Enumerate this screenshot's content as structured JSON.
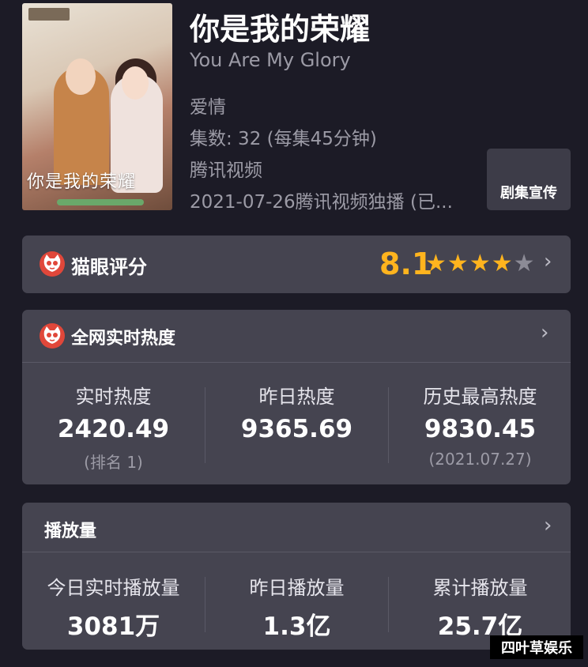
{
  "show": {
    "title": "你是我的荣耀",
    "subtitle": "You Are My Glory",
    "genre": "爱情",
    "episodes": "集数: 32  (每集45分钟)",
    "platform": "腾讯视频",
    "release": "2021-07-26腾讯视频独播 (已...",
    "poster_title": "你是我的荣耀",
    "promo_button": "剧集宣传"
  },
  "rating": {
    "label": "猫眼评分",
    "score": "8.1",
    "stars_filled": 4,
    "stars_total": 5,
    "chevron": "›"
  },
  "heat": {
    "title": "全网实时热度",
    "chevron": "›",
    "stats": [
      {
        "label": "实时热度",
        "value": "2420.49",
        "sub": "(排名 1)"
      },
      {
        "label": "昨日热度",
        "value": "9365.69",
        "sub": ""
      },
      {
        "label": "历史最高热度",
        "value": "9830.45",
        "sub": "(2021.07.27)"
      }
    ]
  },
  "plays": {
    "title": "播放量",
    "chevron": "›",
    "stats": [
      {
        "label": "今日实时播放量",
        "value": "3081万"
      },
      {
        "label": "昨日播放量",
        "value": "1.3亿"
      },
      {
        "label": "累计播放量",
        "value": "25.7亿"
      }
    ]
  },
  "watermark": "四叶草娱乐",
  "colors": {
    "background": "#1c1b26",
    "card": "#454450",
    "accent_score": "#ffb41e",
    "maoyan_red": "#e0473a"
  },
  "icons": [
    "maoyan-cat-icon",
    "chevron-right-icon",
    "star-icon"
  ]
}
